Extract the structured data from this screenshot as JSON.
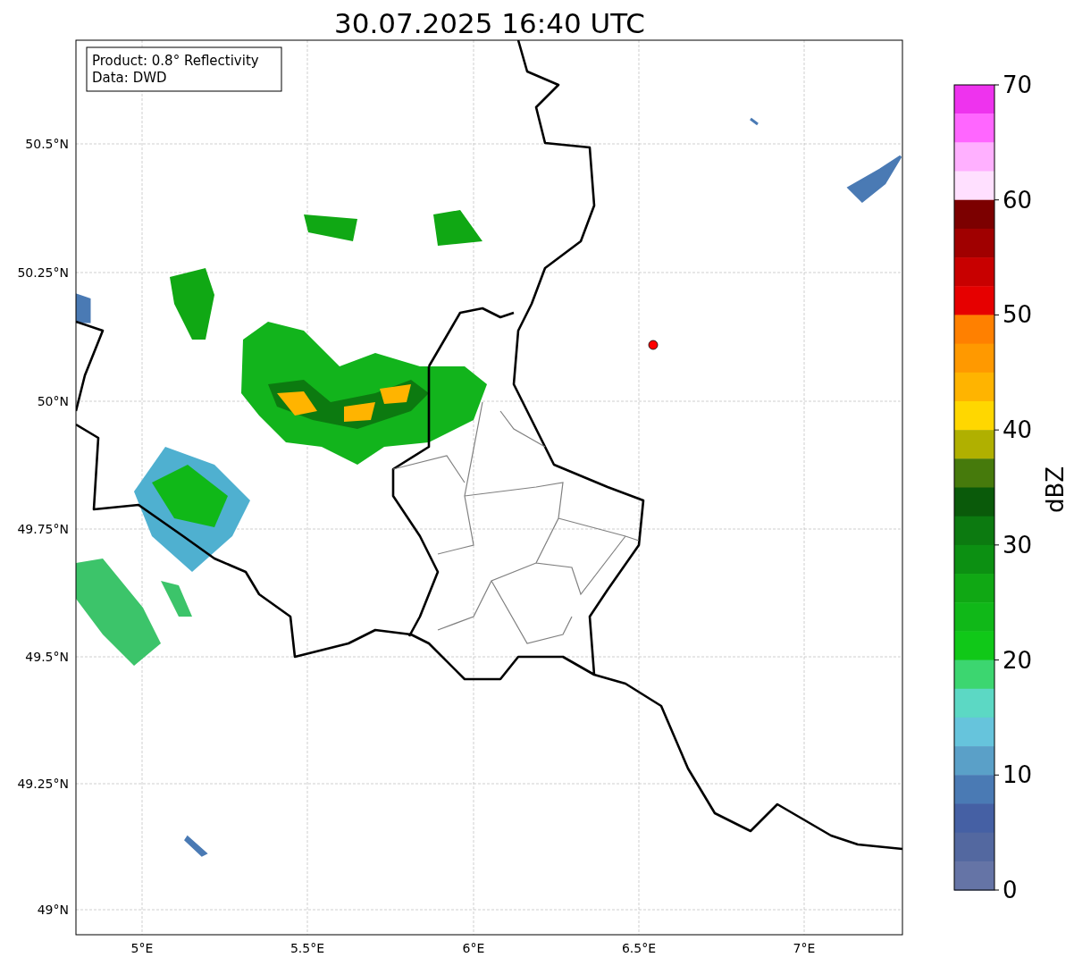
{
  "title": "30.07.2025 16:40 UTC",
  "info_box": [
    "Product: 0.8° Reflectivity",
    "Data: DWD"
  ],
  "map": {
    "yticks": [
      "50.5°N",
      "50.25°N",
      "50°N",
      "49.75°N",
      "49.5°N",
      "49.25°N",
      "49°N"
    ],
    "xticks": [
      "5°E",
      "5.5°E",
      "6°E",
      "6.5°E",
      "7°E"
    ]
  },
  "colorbar": {
    "label": "dBZ",
    "ticks": [
      "70",
      "60",
      "50",
      "40",
      "30",
      "20",
      "10",
      "0"
    ],
    "bins": [
      {
        "color": "#ee33ee"
      },
      {
        "color": "#ff66ff"
      },
      {
        "color": "#ffb0ff"
      },
      {
        "color": "#ffe0ff"
      },
      {
        "color": "#7c0000"
      },
      {
        "color": "#a00000"
      },
      {
        "color": "#c80000"
      },
      {
        "color": "#e60000"
      },
      {
        "color": "#ff8000"
      },
      {
        "color": "#ff9900"
      },
      {
        "color": "#ffb400"
      },
      {
        "color": "#ffd700"
      },
      {
        "color": "#b0b000"
      },
      {
        "color": "#467a0c"
      },
      {
        "color": "#0a5a0a"
      },
      {
        "color": "#0c7a10"
      },
      {
        "color": "#0c9012"
      },
      {
        "color": "#10a814"
      },
      {
        "color": "#10b818"
      },
      {
        "color": "#10c818"
      },
      {
        "color": "#3cd670"
      },
      {
        "color": "#5cd8c4"
      },
      {
        "color": "#66c4dc"
      },
      {
        "color": "#5aa0c8"
      },
      {
        "color": "#4a7ab4"
      },
      {
        "color": "#4560a4"
      },
      {
        "color": "#5368a0"
      },
      {
        "color": "#6574a6"
      }
    ]
  }
}
